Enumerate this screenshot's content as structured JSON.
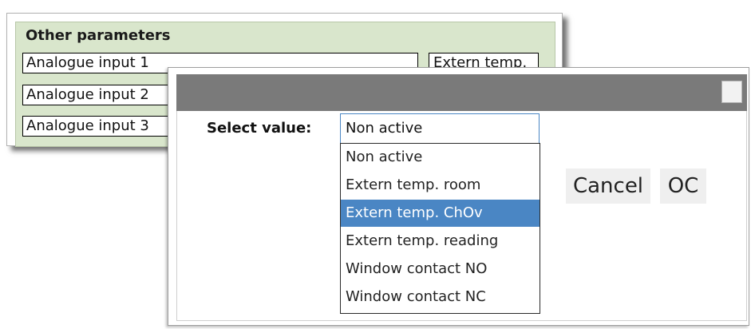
{
  "params": {
    "title": "Other parameters",
    "rows": [
      {
        "label": "Analogue input 1",
        "value": "Extern temp."
      },
      {
        "label": "Analogue input 2"
      },
      {
        "label": "Analogue input 3"
      }
    ]
  },
  "dialog": {
    "select_label": "Select value:",
    "current_value": "Non active",
    "options": [
      "Non active",
      "Extern temp. room",
      "Extern temp. ChOv",
      "Extern temp. reading",
      "Window contact NO",
      "Window contact NC"
    ],
    "highlighted_option": "Extern temp. ChOv",
    "cancel_label": "Cancel",
    "ok_label": "OC"
  },
  "colors": {
    "panel_bg": "#d9e6cc",
    "titlebar": "#7a7a7a",
    "highlight": "#4a86c4"
  }
}
